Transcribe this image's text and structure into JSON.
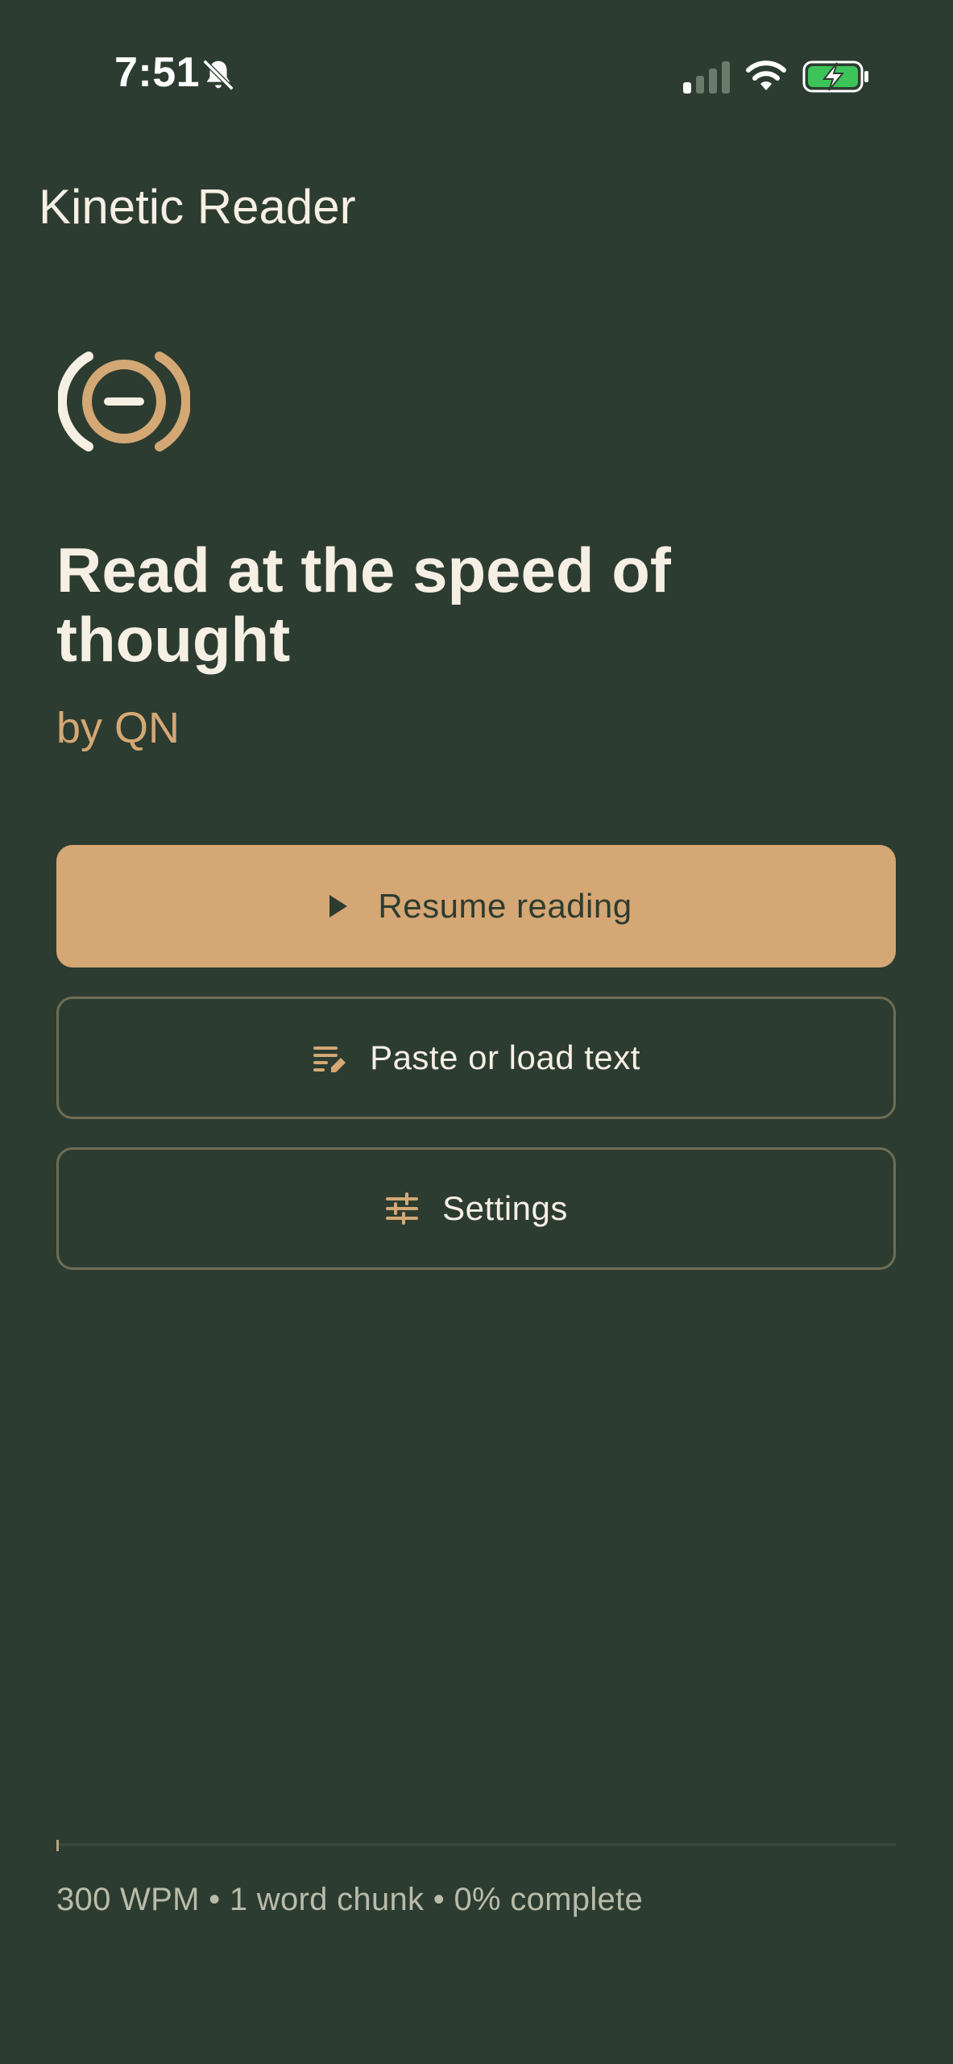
{
  "status_bar": {
    "time": "7:51",
    "icons": [
      "bell-slash-icon",
      "signal-icon",
      "wifi-icon",
      "battery-charging-icon"
    ]
  },
  "app": {
    "title": "Kinetic Reader",
    "logo": "kinetic-reader-logo-icon"
  },
  "hero": {
    "headline": "Read at the speed of thought",
    "byline": "by QN"
  },
  "actions": {
    "resume": {
      "label": "Resume reading",
      "icon": "play-icon"
    },
    "paste": {
      "label": "Paste or load text",
      "icon": "edit-text-icon"
    },
    "settings": {
      "label": "Settings",
      "icon": "sliders-icon"
    }
  },
  "footer": {
    "progress_fraction": 0,
    "stats": "300 WPM • 1 word chunk • 0% complete"
  },
  "colors": {
    "background": "#2d3c30",
    "accent": "#d5a774",
    "text": "#f6efe4",
    "muted": "#b8bcaa",
    "outline": "#6e6e55"
  }
}
